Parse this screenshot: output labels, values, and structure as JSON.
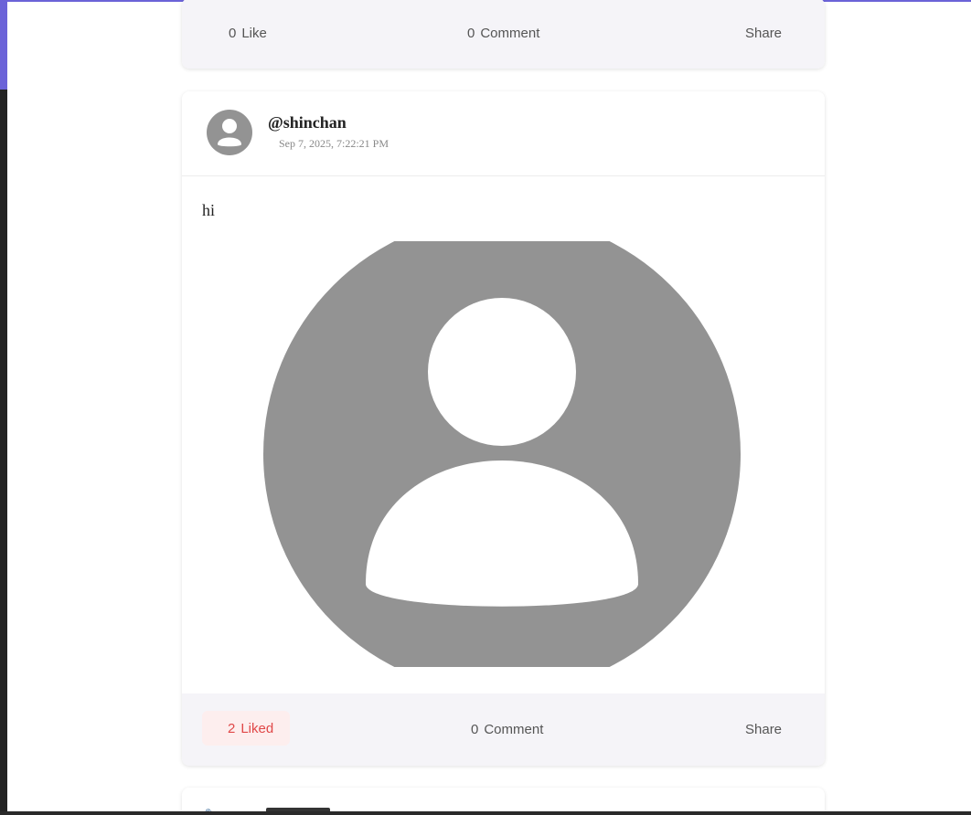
{
  "prev_post": {
    "actions": {
      "like_count": "0",
      "like_label": "Like",
      "comment_count": "0",
      "comment_label": "Comment",
      "share_label": "Share"
    }
  },
  "post": {
    "username": "@shinchan",
    "timestamp": "Sep 7, 2025, 7:22:21 PM",
    "text": "hi",
    "avatar_icon": "user-avatar-icon",
    "image_icon": "default-user-placeholder",
    "actions": {
      "like_count": "2",
      "like_label": "Liked",
      "comment_count": "0",
      "comment_label": "Comment",
      "share_label": "Share"
    }
  },
  "colors": {
    "accent": "#6b63d8",
    "liked": "#e04848",
    "liked_bg": "#fdeeee",
    "action_bar_bg": "#f5f4f8",
    "placeholder_gray": "#939393"
  }
}
